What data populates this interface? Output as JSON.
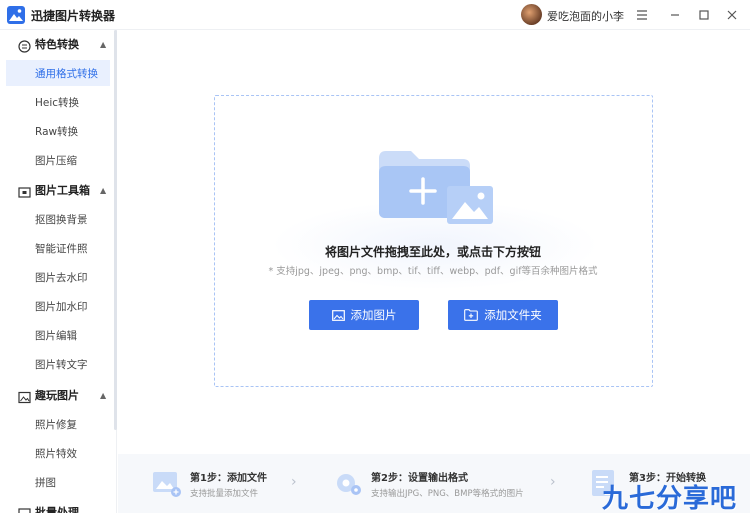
{
  "app": {
    "title": "迅捷图片转换器"
  },
  "user": {
    "name": "爱吃泡面的小李"
  },
  "sidebar": {
    "groups": [
      {
        "label": "特色转换",
        "items": [
          "通用格式转换",
          "Heic转换",
          "Raw转换",
          "图片压缩"
        ]
      },
      {
        "label": "图片工具箱",
        "items": [
          "抠图换背景",
          "智能证件照",
          "图片去水印",
          "图片加水印",
          "图片编辑",
          "图片转文字"
        ]
      },
      {
        "label": "趣玩图片",
        "items": [
          "照片修复",
          "照片特效",
          "拼图"
        ]
      },
      {
        "label": "批量处理"
      }
    ],
    "active_item": "通用格式转换"
  },
  "dropzone": {
    "title": "将图片文件拖拽至此处，或点击下方按钮",
    "subtitle": "* 支持jpg、jpeg、png、bmp、tif、tiff、webp、pdf、gif等百余种图片格式",
    "add_image_label": "添加图片",
    "add_folder_label": "添加文件夹"
  },
  "steps": [
    {
      "title": "第1步：添加文件",
      "desc": "支持批量添加文件"
    },
    {
      "title": "第2步：设置输出格式",
      "desc": "支持输出JPG、PNG、BMP等格式的图片"
    },
    {
      "title": "第3步：开始转换",
      "desc": ""
    }
  ],
  "watermark": "九七分享吧",
  "colors": {
    "accent": "#3a72ea",
    "active_bg": "#e9f0fe",
    "dash": "#a9c4f5"
  }
}
